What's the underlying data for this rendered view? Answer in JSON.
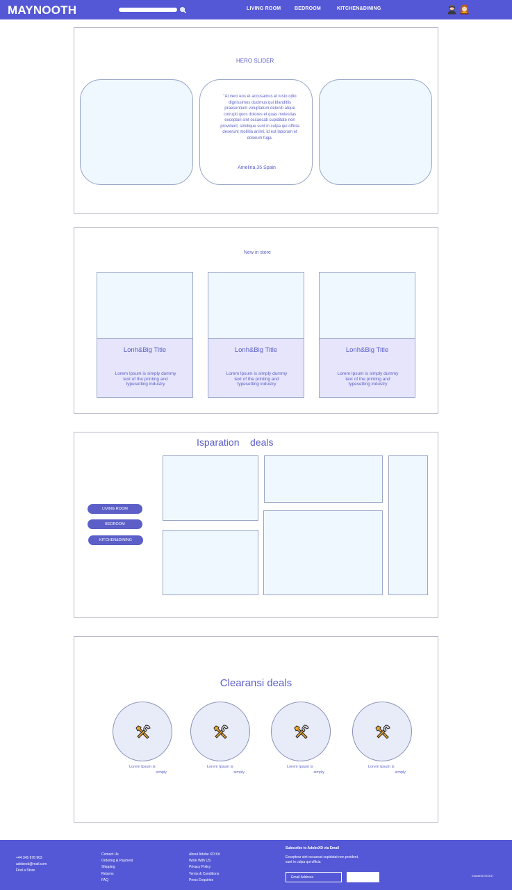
{
  "header": {
    "logo": "MAYNOOTH",
    "search": {
      "value": "",
      "placeholder": "",
      "icon": "magnifier-icon"
    },
    "nav": [
      "LIVING ROOM",
      "BEDROOM",
      "KITCHEN&DINING"
    ],
    "icons": [
      "user-icon",
      "account-icon"
    ],
    "colors": {
      "bar": "#5558d6",
      "text": "#ffffff"
    }
  },
  "hero": {
    "title": "HERO SLIDER",
    "quote": "\"At vero eos et accusamus et iusto odio dignissimos ducimus qui blanditiis praesentium voluptatum deleniti atque corrupti quos dolores et quas molestias excepturi sint occaecati cupiditate non provident, similique sunt in culpa qui officia deserunt mollitia animi, id est laborum et dolorum fuga.",
    "author": "Amelina,35 Spain"
  },
  "new_in_store": {
    "title": "New in store",
    "cards": [
      {
        "title": "Lonh&Big Title",
        "text": "Lorem Ipsum is simply dummy text of the printing and typesetting industry"
      },
      {
        "title": "Lonh&Big Title",
        "text": "Lorem Ipsum is simply dummy text of the printing and typesetting industry"
      },
      {
        "title": "Lonh&Big Title",
        "text": "Lorem Ipsum is simply dummy text of the printing and typesetting industry"
      }
    ]
  },
  "inspiration": {
    "title": "Isparation    deals",
    "buttons": [
      "LIVING ROOM",
      "BEDROOM",
      "KITCHEN&DINING"
    ]
  },
  "clearance": {
    "title": "Clearansi deals",
    "items": [
      {
        "icon": "tools-icon",
        "line1": "Lorem Ipsum is",
        "line2": "simply"
      },
      {
        "icon": "tools-icon",
        "line1": "Lorem Ipsum is",
        "line2": "simply"
      },
      {
        "icon": "tools-icon",
        "line1": "Lorem Ipsum is",
        "line2": "simply"
      },
      {
        "icon": "tools-icon",
        "line1": "Lorem Ipsum is",
        "line2": "simply"
      }
    ]
  },
  "footer": {
    "contact": [
      "+44 345 678 903",
      "adobexd@mail.com",
      "Find a Store"
    ],
    "links1": [
      "Contact Us",
      "Ordering & Payment",
      "Shipping",
      "Returns",
      "FAQ"
    ],
    "links2": [
      "About Adobe XD Kit",
      "Work With US",
      "Privacy Policy",
      "Terms & Conditions",
      "Press Enquiries"
    ],
    "subscribe": {
      "title": "Subscribe to AdobeXD via Email",
      "text": "Excepteur sint occaecat cupidatat non proident, sunt in culpa qui officia",
      "placeholder": "Email Address",
      "button": ""
    },
    "copyright": "©AdobeXD Kit 2017"
  }
}
